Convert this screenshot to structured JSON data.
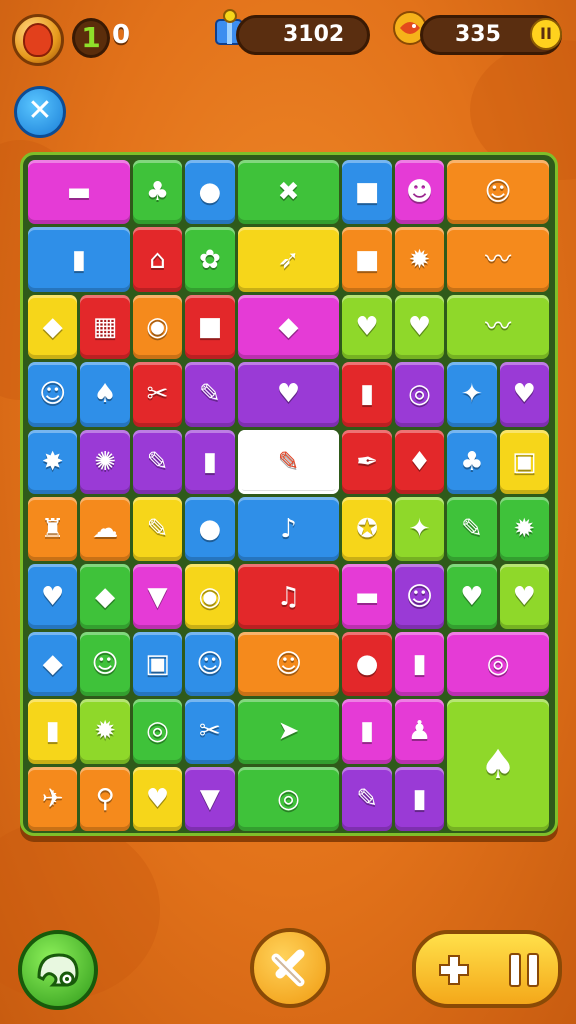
{
  "hud": {
    "level_number": "1",
    "level_extra": "0",
    "score": "3102",
    "coins": "335",
    "pause_label": "II",
    "close_label": "✕"
  },
  "icons": {
    "coin": "shield-coin-icon",
    "score": "gift-box-icon",
    "coins": "fish-coin-icon",
    "hint": "chameleon-icon",
    "shuffle": "cross-swap-icon",
    "add": "plus-icon",
    "pause": "pause-icon"
  },
  "colors": {
    "magenta": "#e53bd6",
    "green": "#3fc23a",
    "blue": "#2f8fe8",
    "orange": "#f58a1c",
    "red": "#e3282a",
    "yellow": "#f6d61a",
    "purple": "#9a3ad6",
    "lime": "#8fd82a",
    "white": "#ffffff"
  },
  "tiles": [
    {
      "r": 0,
      "c": 0,
      "w": 2,
      "h": 1,
      "color": "magenta",
      "icon": "▬",
      "name": "bread"
    },
    {
      "r": 0,
      "c": 2,
      "w": 1,
      "h": 1,
      "color": "green",
      "icon": "♣",
      "name": "pepper"
    },
    {
      "r": 0,
      "c": 3,
      "w": 1,
      "h": 1,
      "color": "blue",
      "icon": "●",
      "name": "potion"
    },
    {
      "r": 0,
      "c": 4,
      "w": 2,
      "h": 1,
      "color": "green",
      "icon": "✖",
      "name": "cross"
    },
    {
      "r": 0,
      "c": 6,
      "w": 1,
      "h": 1,
      "color": "blue",
      "icon": "■",
      "name": "card"
    },
    {
      "r": 0,
      "c": 7,
      "w": 1,
      "h": 1,
      "color": "magenta",
      "icon": "☻",
      "name": "face"
    },
    {
      "r": 0,
      "c": 8,
      "w": 2,
      "h": 1,
      "color": "orange",
      "icon": "☺",
      "name": "creature"
    },
    {
      "r": 1,
      "c": 0,
      "w": 2,
      "h": 1,
      "color": "blue",
      "icon": "▮",
      "name": "jar"
    },
    {
      "r": 1,
      "c": 2,
      "w": 1,
      "h": 1,
      "color": "red",
      "icon": "⌂",
      "name": "house"
    },
    {
      "r": 1,
      "c": 3,
      "w": 1,
      "h": 1,
      "color": "green",
      "icon": "✿",
      "name": "flower"
    },
    {
      "r": 1,
      "c": 4,
      "w": 2,
      "h": 1,
      "color": "yellow",
      "icon": "➶",
      "name": "arrow"
    },
    {
      "r": 1,
      "c": 6,
      "w": 1,
      "h": 1,
      "color": "orange",
      "icon": "■",
      "name": "cheese"
    },
    {
      "r": 1,
      "c": 7,
      "w": 1,
      "h": 1,
      "color": "orange",
      "icon": "✹",
      "name": "sun"
    },
    {
      "r": 1,
      "c": 8,
      "w": 2,
      "h": 1,
      "color": "orange",
      "icon": "〰",
      "name": "fish"
    },
    {
      "r": 2,
      "c": 0,
      "w": 1,
      "h": 1,
      "color": "yellow",
      "icon": "◆",
      "name": "gem"
    },
    {
      "r": 2,
      "c": 1,
      "w": 1,
      "h": 1,
      "color": "red",
      "icon": "▦",
      "name": "box"
    },
    {
      "r": 2,
      "c": 2,
      "w": 1,
      "h": 1,
      "color": "orange",
      "icon": "◉",
      "name": "ring"
    },
    {
      "r": 2,
      "c": 3,
      "w": 1,
      "h": 1,
      "color": "red",
      "icon": "■",
      "name": "cake"
    },
    {
      "r": 2,
      "c": 4,
      "w": 2,
      "h": 1,
      "color": "magenta",
      "icon": "◆",
      "name": "crystal"
    },
    {
      "r": 2,
      "c": 6,
      "w": 1,
      "h": 1,
      "color": "lime",
      "icon": "♥",
      "name": "heart-face"
    },
    {
      "r": 2,
      "c": 7,
      "w": 1,
      "h": 1,
      "color": "lime",
      "icon": "♥",
      "name": "heart-face-2"
    },
    {
      "r": 2,
      "c": 8,
      "w": 2,
      "h": 1,
      "color": "lime",
      "icon": "〰",
      "name": "cloud"
    },
    {
      "r": 3,
      "c": 0,
      "w": 1,
      "h": 1,
      "color": "blue",
      "icon": "☺",
      "name": "blob"
    },
    {
      "r": 3,
      "c": 1,
      "w": 1,
      "h": 1,
      "color": "blue",
      "icon": "♠",
      "name": "chili"
    },
    {
      "r": 3,
      "c": 2,
      "w": 1,
      "h": 1,
      "color": "red",
      "icon": "✂",
      "name": "scissors"
    },
    {
      "r": 3,
      "c": 3,
      "w": 1,
      "h": 1,
      "color": "purple",
      "icon": "✎",
      "name": "horn"
    },
    {
      "r": 3,
      "c": 4,
      "w": 2,
      "h": 1,
      "color": "purple",
      "icon": "♥",
      "name": "heart"
    },
    {
      "r": 3,
      "c": 6,
      "w": 1,
      "h": 1,
      "color": "red",
      "icon": "▮",
      "name": "tube"
    },
    {
      "r": 3,
      "c": 7,
      "w": 1,
      "h": 1,
      "color": "purple",
      "icon": "◎",
      "name": "donut"
    },
    {
      "r": 3,
      "c": 8,
      "w": 1,
      "h": 1,
      "color": "blue",
      "icon": "✦",
      "name": "banana"
    },
    {
      "r": 3,
      "c": 9,
      "w": 1,
      "h": 1,
      "color": "purple",
      "icon": "♥",
      "name": "heart-dots"
    },
    {
      "r": 4,
      "c": 0,
      "w": 1,
      "h": 1,
      "color": "blue",
      "icon": "✸",
      "name": "gear"
    },
    {
      "r": 4,
      "c": 1,
      "w": 1,
      "h": 1,
      "color": "purple",
      "icon": "✺",
      "name": "shell"
    },
    {
      "r": 4,
      "c": 2,
      "w": 1,
      "h": 1,
      "color": "purple",
      "icon": "✎",
      "name": "trumpet"
    },
    {
      "r": 4,
      "c": 3,
      "w": 1,
      "h": 1,
      "color": "purple",
      "icon": "▮",
      "name": "bottle"
    },
    {
      "r": 4,
      "c": 4,
      "w": 2,
      "h": 1,
      "color": "white",
      "icon": "✎",
      "name": "selected-tool",
      "sel": true
    },
    {
      "r": 4,
      "c": 6,
      "w": 1,
      "h": 1,
      "color": "red",
      "icon": "✒",
      "name": "pen"
    },
    {
      "r": 4,
      "c": 7,
      "w": 1,
      "h": 1,
      "color": "red",
      "icon": "♦",
      "name": "ghost"
    },
    {
      "r": 4,
      "c": 8,
      "w": 1,
      "h": 1,
      "color": "blue",
      "icon": "♣",
      "name": "shirt"
    },
    {
      "r": 4,
      "c": 9,
      "w": 1,
      "h": 1,
      "color": "yellow",
      "icon": "▣",
      "name": "radio"
    },
    {
      "r": 5,
      "c": 0,
      "w": 1,
      "h": 1,
      "color": "orange",
      "icon": "♜",
      "name": "sock"
    },
    {
      "r": 5,
      "c": 1,
      "w": 1,
      "h": 1,
      "color": "orange",
      "icon": "☁",
      "name": "cloud-blue"
    },
    {
      "r": 5,
      "c": 2,
      "w": 1,
      "h": 1,
      "color": "yellow",
      "icon": "✎",
      "name": "carrot"
    },
    {
      "r": 5,
      "c": 3,
      "w": 1,
      "h": 1,
      "color": "blue",
      "icon": "●",
      "name": "pink-blob"
    },
    {
      "r": 5,
      "c": 4,
      "w": 2,
      "h": 1,
      "color": "blue",
      "icon": "♪",
      "name": "note"
    },
    {
      "r": 5,
      "c": 6,
      "w": 1,
      "h": 1,
      "color": "yellow",
      "icon": "✪",
      "name": "star-badge"
    },
    {
      "r": 5,
      "c": 7,
      "w": 1,
      "h": 1,
      "color": "lime",
      "icon": "✦",
      "name": "wand"
    },
    {
      "r": 5,
      "c": 8,
      "w": 1,
      "h": 1,
      "color": "green",
      "icon": "✎",
      "name": "carrot-2"
    },
    {
      "r": 5,
      "c": 9,
      "w": 1,
      "h": 1,
      "color": "green",
      "icon": "✹",
      "name": "cookie"
    },
    {
      "r": 6,
      "c": 0,
      "w": 1,
      "h": 1,
      "color": "blue",
      "icon": "♥",
      "name": "pink-heart"
    },
    {
      "r": 6,
      "c": 1,
      "w": 1,
      "h": 1,
      "color": "green",
      "icon": "◆",
      "name": "kite"
    },
    {
      "r": 6,
      "c": 2,
      "w": 1,
      "h": 1,
      "color": "magenta",
      "icon": "▼",
      "name": "cone"
    },
    {
      "r": 6,
      "c": 3,
      "w": 1,
      "h": 1,
      "color": "yellow",
      "icon": "◉",
      "name": "snail"
    },
    {
      "r": 6,
      "c": 4,
      "w": 2,
      "h": 1,
      "color": "red",
      "icon": "♫",
      "name": "trumpet-2"
    },
    {
      "r": 6,
      "c": 6,
      "w": 1,
      "h": 1,
      "color": "magenta",
      "icon": "▬",
      "name": "eraser"
    },
    {
      "r": 6,
      "c": 7,
      "w": 1,
      "h": 1,
      "color": "purple",
      "icon": "☺",
      "name": "bun"
    },
    {
      "r": 6,
      "c": 8,
      "w": 1,
      "h": 1,
      "color": "green",
      "icon": "♥",
      "name": "heart-green"
    },
    {
      "r": 6,
      "c": 9,
      "w": 1,
      "h": 1,
      "color": "lime",
      "icon": "♥",
      "name": "heart-lime"
    },
    {
      "r": 7,
      "c": 0,
      "w": 1,
      "h": 1,
      "color": "blue",
      "icon": "◆",
      "name": "diamond"
    },
    {
      "r": 7,
      "c": 1,
      "w": 1,
      "h": 1,
      "color": "green",
      "icon": "☺",
      "name": "drop"
    },
    {
      "r": 7,
      "c": 2,
      "w": 1,
      "h": 1,
      "color": "blue",
      "icon": "▣",
      "name": "juice"
    },
    {
      "r": 7,
      "c": 3,
      "w": 1,
      "h": 1,
      "color": "blue",
      "icon": "☺",
      "name": "duck"
    },
    {
      "r": 7,
      "c": 4,
      "w": 2,
      "h": 1,
      "color": "orange",
      "icon": "☺",
      "name": "potato"
    },
    {
      "r": 7,
      "c": 6,
      "w": 1,
      "h": 1,
      "color": "red",
      "icon": "●",
      "name": "ball"
    },
    {
      "r": 7,
      "c": 7,
      "w": 1,
      "h": 1,
      "color": "magenta",
      "icon": "▮",
      "name": "traffic"
    },
    {
      "r": 7,
      "c": 8,
      "w": 2,
      "h": 1,
      "color": "magenta",
      "icon": "◎",
      "name": "cookie-pink"
    },
    {
      "r": 8,
      "c": 0,
      "w": 1,
      "h": 1,
      "color": "yellow",
      "icon": "▮",
      "name": "lotion"
    },
    {
      "r": 8,
      "c": 1,
      "w": 1,
      "h": 1,
      "color": "lime",
      "icon": "✹",
      "name": "urchin"
    },
    {
      "r": 8,
      "c": 2,
      "w": 1,
      "h": 1,
      "color": "green",
      "icon": "◎",
      "name": "eye"
    },
    {
      "r": 8,
      "c": 3,
      "w": 1,
      "h": 1,
      "color": "blue",
      "icon": "✂",
      "name": "twig"
    },
    {
      "r": 8,
      "c": 4,
      "w": 2,
      "h": 1,
      "color": "green",
      "icon": "➤",
      "name": "plane"
    },
    {
      "r": 8,
      "c": 6,
      "w": 1,
      "h": 1,
      "color": "magenta",
      "icon": "▮",
      "name": "phone"
    },
    {
      "r": 8,
      "c": 7,
      "w": 1,
      "h": 1,
      "color": "magenta",
      "icon": "♟",
      "name": "pig"
    },
    {
      "r": 8,
      "c": 8,
      "w": 2,
      "h": 2,
      "color": "lime",
      "icon": "♠",
      "name": "jelly"
    },
    {
      "r": 9,
      "c": 0,
      "w": 1,
      "h": 1,
      "color": "orange",
      "icon": "✈",
      "name": "rocket"
    },
    {
      "r": 9,
      "c": 1,
      "w": 1,
      "h": 1,
      "color": "orange",
      "icon": "⚲",
      "name": "magnifier"
    },
    {
      "r": 9,
      "c": 2,
      "w": 1,
      "h": 1,
      "color": "yellow",
      "icon": "♥",
      "name": "heart-pink"
    },
    {
      "r": 9,
      "c": 3,
      "w": 1,
      "h": 1,
      "color": "purple",
      "icon": "▼",
      "name": "icecream"
    },
    {
      "r": 9,
      "c": 4,
      "w": 2,
      "h": 1,
      "color": "green",
      "icon": "◎",
      "name": "target"
    },
    {
      "r": 9,
      "c": 6,
      "w": 1,
      "h": 1,
      "color": "purple",
      "icon": "✎",
      "name": "marker"
    },
    {
      "r": 9,
      "c": 7,
      "w": 1,
      "h": 1,
      "color": "purple",
      "icon": "▮",
      "name": "can"
    }
  ]
}
